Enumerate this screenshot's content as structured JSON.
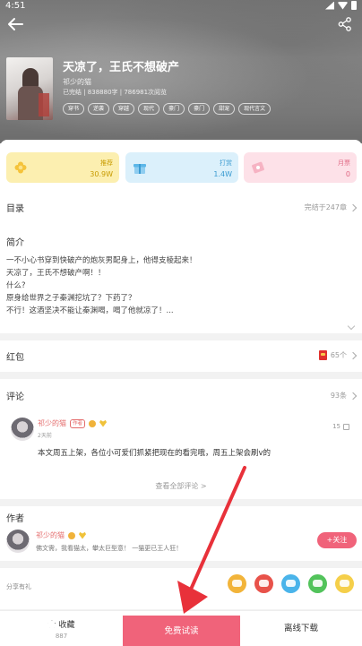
{
  "status_bar": {
    "time": "4:51"
  },
  "book": {
    "title": "天凉了，王氏不想破产",
    "author": "祁少的猫",
    "stats": "已完结 | 838880字 | 786981次阅览",
    "tags": [
      "穿书",
      "逆袭",
      "穿越",
      "现代",
      "豪门",
      "豪门",
      "甜宠",
      "现代言文"
    ]
  },
  "cards": [
    {
      "label": "推荐",
      "value": "30.9W",
      "icon": "flower-icon",
      "color": "#c89b00"
    },
    {
      "label": "打赏",
      "value": "1.4W",
      "icon": "gift-icon",
      "color": "#3b9bd1"
    },
    {
      "label": "月票",
      "value": "0",
      "icon": "ticket-icon",
      "color": "#e06883"
    }
  ],
  "catalog": {
    "title": "目录",
    "status": "完结于247章"
  },
  "intro": {
    "title": "简介",
    "lines": [
      "一不小心书穿到快破产的炮灰男配身上，他得支棱起来！",
      "天凉了，王氏不想破产啊！！",
      "什么?",
      "原身给世界之子秦渊挖坑了？下药了？",
      "不行！这酒坚决不能让秦渊喝，喝了他就凉了！..."
    ]
  },
  "red_envelope": {
    "title": "红包",
    "count": "65个"
  },
  "comments": {
    "title": "评论",
    "count": "93条",
    "items": [
      {
        "user": "祁少的猫",
        "badge": "作者",
        "days": "2天前",
        "likes": "15",
        "text": "本文周五上架，各位小可爱们抓紧把现在的看完哦，周五上架会刷v的"
      }
    ],
    "view_all": "查看全部评论 >"
  },
  "author_section": {
    "title": "作者",
    "name": "祁少的猫",
    "desc": "佛文需，我看猫太，攀太巨型意！ 一猫更已王人狂！",
    "follow": "+关注"
  },
  "share": {
    "label": "分享有礼",
    "icons": [
      {
        "name": "message-share-icon",
        "color": "#f2b43a"
      },
      {
        "name": "weibo-share-icon",
        "color": "#e8524a"
      },
      {
        "name": "qq-share-icon",
        "color": "#4ab4ea"
      },
      {
        "name": "wechat-share-icon",
        "color": "#52c35b"
      },
      {
        "name": "more-share-icon",
        "color": "#f5cf4a"
      }
    ]
  },
  "bottom": {
    "favorite": "收藏",
    "favorite_count": "887",
    "read": "免费试读",
    "download": "离线下载"
  },
  "colors": {
    "accent": "#f0637a",
    "annotation": "#e8313a"
  }
}
